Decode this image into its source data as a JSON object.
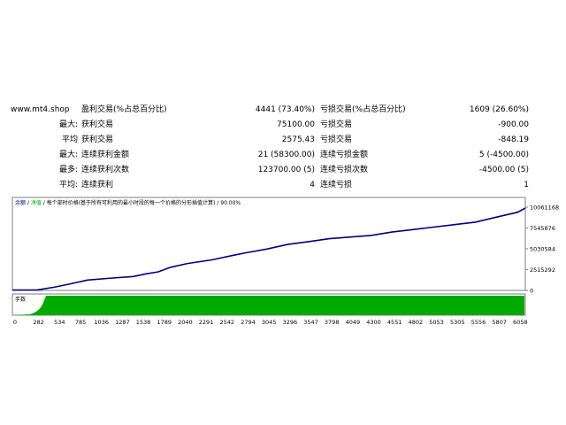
{
  "report": {
    "site": "www.mt4.shop",
    "rows": [
      {
        "pre": "",
        "label1": "盈利交易(%占总百分比)",
        "value1": "4441 (73.40%)",
        "label2": "亏损交易(%占总百分比)",
        "value2": "1609 (26.60%)"
      },
      {
        "pre": "最大:",
        "label1": "获利交易",
        "value1": "75100.00",
        "label2": "亏损交易",
        "value2": "-900.00"
      },
      {
        "pre": "平均",
        "label1": "获利交易",
        "value1": "2575.43",
        "label2": "亏损交易",
        "value2": "-848.19"
      },
      {
        "pre": "最大:",
        "label1": "连续获利金额",
        "value1": "21 (58300.00)",
        "label2": "连续亏损金额",
        "value2": "5 (-4500.00)"
      },
      {
        "pre": "最多:",
        "label1": "连续获利次数",
        "value1": "123700.00 (5)",
        "label2": "连续亏损次数",
        "value2": "-4500.00 (5)"
      },
      {
        "pre": "平均:",
        "label1": "连续获利",
        "value1": "4",
        "label2": "连续亏损",
        "value2": "1"
      }
    ]
  },
  "chart_data": {
    "type": "line",
    "legend": {
      "balance": "余额",
      "sep1": " / ",
      "equity": "净值",
      "sep2": " / ",
      "description": "每个部时价格(基于所有可利用的最小时段的每一个价格的分形插值计算)",
      "sep3": " / ",
      "quality": "90.00%"
    },
    "y_ticks": [
      "10061168",
      "7545876",
      "5030584",
      "2515292",
      "0"
    ],
    "y_tick_values": [
      10061168,
      7545876,
      5030584,
      2515292,
      0
    ],
    "ylim": [
      0,
      10061168
    ],
    "x_ticks": [
      "0",
      "282",
      "534",
      "785",
      "1036",
      "1287",
      "1538",
      "1789",
      "2040",
      "2291",
      "2542",
      "2794",
      "3045",
      "3296",
      "3547",
      "3798",
      "4049",
      "4300",
      "4551",
      "4802",
      "5053",
      "5305",
      "5556",
      "5807",
      "6058"
    ],
    "xlim": [
      0,
      6150
    ],
    "series": [
      {
        "name": "余额",
        "color": "#000080",
        "x": [
          0,
          300,
          500,
          700,
          900,
          1200,
          1450,
          1600,
          1750,
          1900,
          2100,
          2400,
          2650,
          2800,
          3050,
          3300,
          3550,
          3800,
          4050,
          4300,
          4550,
          4800,
          5050,
          5300,
          5550,
          5800,
          6058,
          6150
        ],
        "y": [
          50000,
          60000,
          380000,
          800000,
          1250000,
          1500000,
          1680000,
          2000000,
          2250000,
          2800000,
          3250000,
          3700000,
          4250000,
          4550000,
          5000000,
          5550000,
          5900000,
          6250000,
          6450000,
          6650000,
          7050000,
          7350000,
          7650000,
          7950000,
          8250000,
          8850000,
          9450000,
          9950000
        ]
      }
    ],
    "volume_panel": {
      "label": "手数",
      "color": "#00aa00"
    },
    "grid": false
  }
}
